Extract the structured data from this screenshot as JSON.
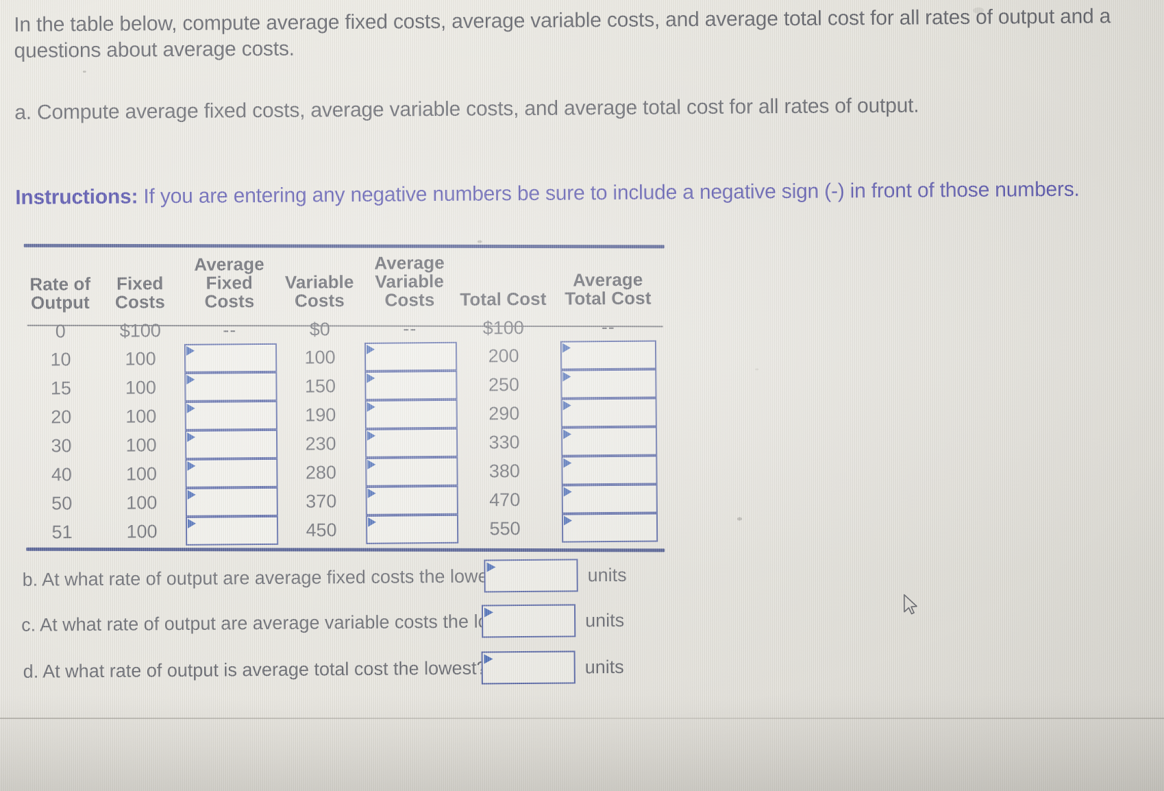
{
  "intro": {
    "line1": "In the table below, compute average fixed costs, average variable costs, and average total cost for all rates of output and a",
    "line2": "questions about average costs."
  },
  "part_a": "a. Compute average fixed costs, average variable costs, and average total cost for all rates of output.",
  "instructions": {
    "label": "Instructions:",
    "text": " If you are entering any negative numbers be sure to include a negative sign (-) in front of those numbers."
  },
  "table": {
    "headers": [
      "Rate of Output",
      "Fixed Costs",
      "Average Fixed Costs",
      "Variable Costs",
      "Average Variable Costs",
      "Total Cost",
      "Average Total Cost"
    ],
    "header_lines": [
      [
        "Rate of",
        "Output"
      ],
      [
        "Fixed",
        "Costs"
      ],
      [
        "Average",
        "Fixed",
        "Costs"
      ],
      [
        "Variable",
        "Costs"
      ],
      [
        "Average",
        "Variable",
        "Costs"
      ],
      [
        "Total Cost"
      ],
      [
        "Average",
        "Total Cost"
      ]
    ],
    "dash": "--",
    "rows": [
      {
        "rate": "0",
        "fixed_costs": "$100",
        "avg_fixed_costs": "--",
        "variable_costs": "$0",
        "avg_variable_costs": "--",
        "total_cost": "$100",
        "avg_total_cost": "--"
      },
      {
        "rate": "10",
        "fixed_costs": "100",
        "avg_fixed_costs": "",
        "variable_costs": "100",
        "avg_variable_costs": "",
        "total_cost": "200",
        "avg_total_cost": ""
      },
      {
        "rate": "15",
        "fixed_costs": "100",
        "avg_fixed_costs": "",
        "variable_costs": "150",
        "avg_variable_costs": "",
        "total_cost": "250",
        "avg_total_cost": ""
      },
      {
        "rate": "20",
        "fixed_costs": "100",
        "avg_fixed_costs": "",
        "variable_costs": "190",
        "avg_variable_costs": "",
        "total_cost": "290",
        "avg_total_cost": ""
      },
      {
        "rate": "30",
        "fixed_costs": "100",
        "avg_fixed_costs": "",
        "variable_costs": "230",
        "avg_variable_costs": "",
        "total_cost": "330",
        "avg_total_cost": ""
      },
      {
        "rate": "40",
        "fixed_costs": "100",
        "avg_fixed_costs": "",
        "variable_costs": "280",
        "avg_variable_costs": "",
        "total_cost": "380",
        "avg_total_cost": ""
      },
      {
        "rate": "50",
        "fixed_costs": "100",
        "avg_fixed_costs": "",
        "variable_costs": "370",
        "avg_variable_costs": "",
        "total_cost": "470",
        "avg_total_cost": ""
      },
      {
        "rate": "51",
        "fixed_costs": "100",
        "avg_fixed_costs": "",
        "variable_costs": "450",
        "avg_variable_costs": "",
        "total_cost": "550",
        "avg_total_cost": ""
      }
    ]
  },
  "questions": [
    {
      "id": "b",
      "text": "b. At what rate of output are average fixed costs the lowest?",
      "value": "",
      "units": "units"
    },
    {
      "id": "c",
      "text": "c. At what rate of output are average variable costs the lowest?",
      "value": "",
      "units": "units"
    },
    {
      "id": "d",
      "text": "d. At what rate of output is average total cost the lowest?",
      "value": "",
      "units": "units"
    }
  ],
  "colors": {
    "rule": "#3d4a86",
    "instruction_text": "#4a46a8",
    "input_border": "#4a5aa0",
    "input_marker": "#3f63b3",
    "body_text": "#585a62",
    "page_bg": "#e9e7e0"
  }
}
